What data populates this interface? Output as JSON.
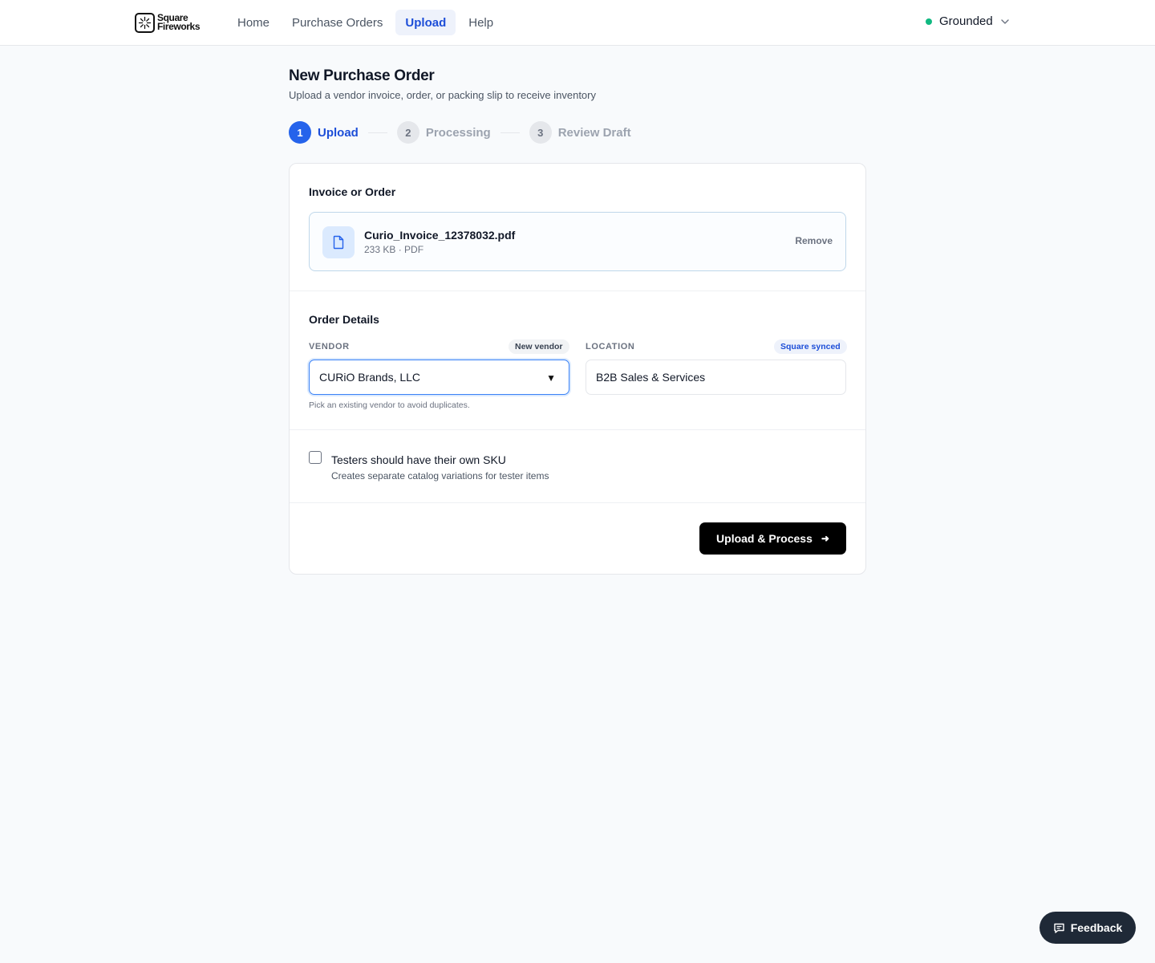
{
  "header": {
    "brand": {
      "line1": "Square",
      "line2": "Fireworks"
    },
    "nav": [
      {
        "label": "Home"
      },
      {
        "label": "Purchase Orders"
      },
      {
        "label": "Upload"
      },
      {
        "label": "Help"
      }
    ],
    "nav_active": "Upload",
    "account": {
      "name": "Grounded",
      "status_color": "#10b981"
    }
  },
  "page": {
    "title": "New Purchase Order",
    "subtitle": "Upload a vendor invoice, order, or packing slip to receive inventory"
  },
  "stepper": {
    "steps": [
      {
        "num": "1",
        "label": "Upload"
      },
      {
        "num": "2",
        "label": "Processing"
      },
      {
        "num": "3",
        "label": "Review Draft"
      }
    ],
    "current": 1
  },
  "upload": {
    "section_title": "Invoice or Order",
    "file": {
      "name": "Curio_Invoice_12378032.pdf",
      "meta": "233 KB · PDF"
    },
    "remove_label": "Remove"
  },
  "details": {
    "section_title": "Order Details",
    "vendor": {
      "label": "VENDOR",
      "badge": "New vendor",
      "value": "CURiO Brands, LLC",
      "hint": "Pick an existing vendor to avoid duplicates."
    },
    "location": {
      "label": "LOCATION",
      "badge": "Square synced",
      "value": "B2B Sales & Services"
    }
  },
  "options": {
    "testers": {
      "label": "Testers should have their own SKU",
      "description": "Creates separate catalog variations for tester items",
      "checked": false
    }
  },
  "actions": {
    "submit_label": "Upload & Process"
  },
  "feedback": {
    "label": "Feedback"
  },
  "colors": {
    "accent": "#2563eb",
    "primary_button": "#000000",
    "feedback_bg": "#1f2937"
  }
}
